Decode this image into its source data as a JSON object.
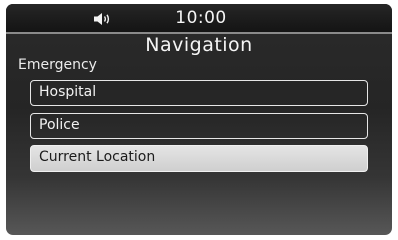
{
  "status_bar": {
    "volume_icon": "volume-icon",
    "time": "10:00"
  },
  "header": {
    "title": "Navigation"
  },
  "section": {
    "label": "Emergency"
  },
  "menu": {
    "items": [
      {
        "label": "Hospital",
        "selected": false
      },
      {
        "label": "Police",
        "selected": false
      },
      {
        "label": "Current Location",
        "selected": true
      }
    ]
  },
  "colors": {
    "background": "#2b2b2b",
    "status_bar": "#141414",
    "item_border": "#e6e6e6",
    "selected_fill": "#d9d9d9",
    "selected_text": "#1c1c1c"
  }
}
